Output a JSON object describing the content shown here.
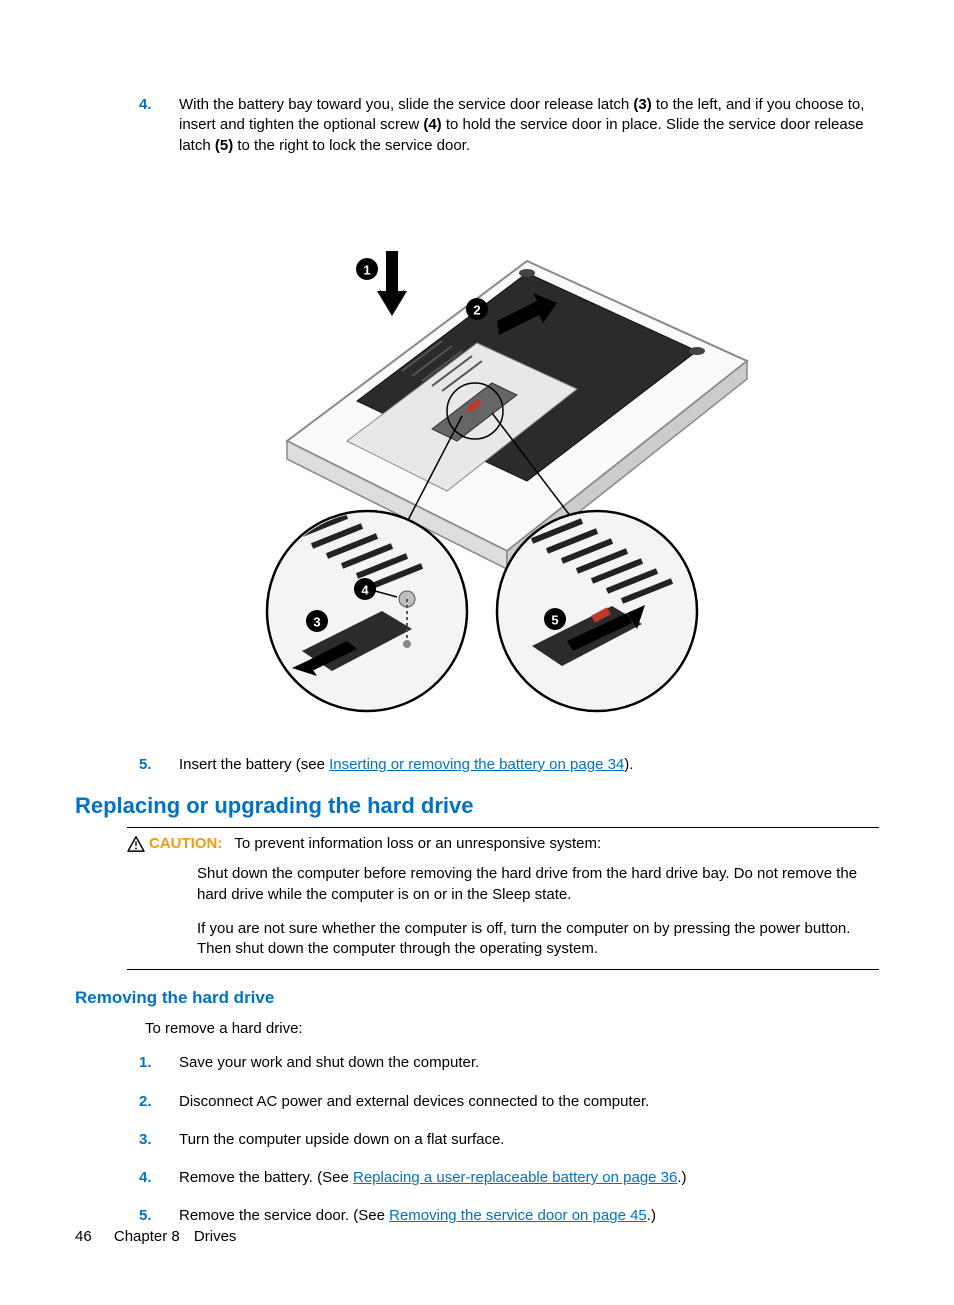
{
  "steps_top": [
    {
      "num": "4.",
      "text_parts": [
        {
          "t": "With the battery bay toward you, slide the service door release latch "
        },
        {
          "t": "(3)",
          "bold": true
        },
        {
          "t": " to the left, and if you choose to, insert and tighten the optional screw "
        },
        {
          "t": "(4)",
          "bold": true
        },
        {
          "t": " to hold the service door in place. Slide the service door release latch "
        },
        {
          "t": "(5)",
          "bold": true
        },
        {
          "t": " to the right to lock the service door."
        }
      ]
    },
    {
      "num": "5.",
      "text_parts": [
        {
          "t": "Insert the battery (see "
        },
        {
          "t": "Inserting or removing the battery on page 34",
          "link": true
        },
        {
          "t": ")."
        }
      ]
    }
  ],
  "heading_h2": "Replacing or upgrading the hard drive",
  "caution": {
    "label": "CAUTION:",
    "lead": "To prevent information loss or an unresponsive system:",
    "para1": "Shut down the computer before removing the hard drive from the hard drive bay. Do not remove the hard drive while the computer is on or in the Sleep state.",
    "para2": "If you are not sure whether the computer is off, turn the computer on by pressing the power button. Then shut down the computer through the operating system."
  },
  "heading_h3": "Removing the hard drive",
  "intro_text": "To remove a hard drive:",
  "steps_bottom": [
    {
      "num": "1.",
      "text_parts": [
        {
          "t": "Save your work and shut down the computer."
        }
      ]
    },
    {
      "num": "2.",
      "text_parts": [
        {
          "t": "Disconnect AC power and external devices connected to the computer."
        }
      ]
    },
    {
      "num": "3.",
      "text_parts": [
        {
          "t": "Turn the computer upside down on a flat surface."
        }
      ]
    },
    {
      "num": "4.",
      "text_parts": [
        {
          "t": "Remove the battery. (See "
        },
        {
          "t": "Replacing a user-replaceable battery on page 36",
          "link": true
        },
        {
          "t": ".)"
        }
      ]
    },
    {
      "num": "5.",
      "text_parts": [
        {
          "t": "Remove the service door. (See "
        },
        {
          "t": "Removing the service door on page 45",
          "link": true
        },
        {
          "t": ".)"
        }
      ]
    }
  ],
  "footer": {
    "page_num": "46",
    "chapter": "Chapter 8",
    "title": "Drives"
  },
  "diagram_callouts": [
    "1",
    "2",
    "3",
    "4",
    "5"
  ]
}
